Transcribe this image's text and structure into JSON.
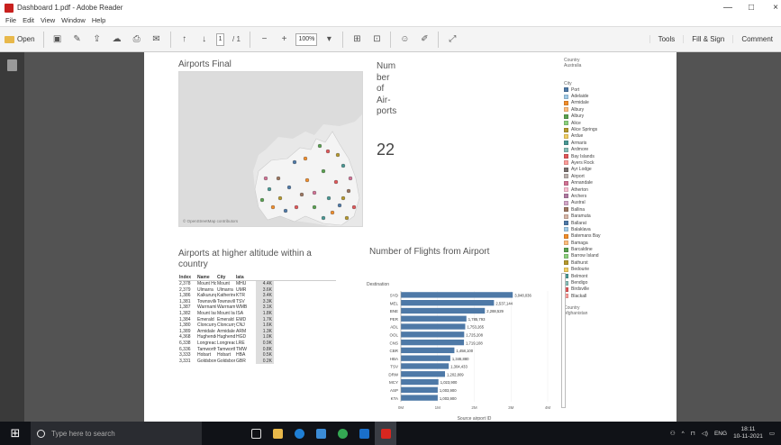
{
  "window": {
    "title": "Dashboard 1.pdf - Adobe Reader",
    "controls": [
      "—",
      "□",
      "×"
    ]
  },
  "menu": [
    "File",
    "Edit",
    "View",
    "Window",
    "Help"
  ],
  "toolbar": {
    "open_label": "Open",
    "page_current": "1",
    "page_total": "/ 1",
    "zoom": "100%",
    "right_tabs": [
      "Tools",
      "Fill & Sign",
      "Comment"
    ]
  },
  "dashboard": {
    "map_title": "Airports Final",
    "map_attribution": "© OpenStreetMap contributors",
    "num_title_lines": [
      "Num",
      "ber",
      "of",
      "Air-",
      "ports"
    ],
    "num_value": "22",
    "table_title_lines": [
      "Airports at higher altitude within a",
      "country"
    ],
    "table_headers": [
      "Index",
      "Name",
      "City",
      "Iata",
      ""
    ],
    "table_rows": [
      [
        "2,378",
        "Mount Hotham",
        "Mount",
        "MHU",
        "4.4K"
      ],
      [
        "2,379",
        "Ulmarra",
        "Ulmarra",
        "UMR",
        "3.6K"
      ],
      [
        "1,386",
        "Kalkurung",
        "Katherine",
        "KTR",
        "3.4K"
      ],
      [
        "1,381",
        "Townsville",
        "Townsville",
        "TSV",
        "3.3K"
      ],
      [
        "1,387",
        "Warrnambool",
        "Warrnambool",
        "WMB",
        "3.1K"
      ],
      [
        "1,382",
        "Mount Isa",
        "Mount Isa",
        "ISA",
        "1.8K"
      ],
      [
        "1,384",
        "Emerald",
        "Emerald",
        "EMD",
        "1.7K"
      ],
      [
        "1,380",
        "Cloncurry",
        "Cloncurry",
        "CNJ",
        "1.6K"
      ],
      [
        "1,389",
        "Armidale",
        "Armidale",
        "ARM",
        "1.3K"
      ],
      [
        "4,368",
        "Hughenden",
        "Hughenden",
        "HGD",
        "1.0K"
      ],
      [
        "6,338",
        "Longreach",
        "Longreach",
        "LRE",
        "0.9K"
      ],
      [
        "6,336",
        "Tamworth",
        "Tamworth",
        "TMW",
        "0.8K"
      ],
      [
        "3,333",
        "Hobart",
        "Hobart",
        "HBA",
        "0.5K"
      ],
      [
        "3,331",
        "Goldsborough",
        "Goldsborough",
        "GBR",
        "0.2K"
      ]
    ],
    "chart_title": "Number of Flights from Airport",
    "legend_country_label": "Country",
    "legend_country_value": "Australia",
    "legend_city_label": "City",
    "legend_cities": [
      {
        "name": "Port",
        "color": "#4e79a7"
      },
      {
        "name": "Adelaide",
        "color": "#a0cbe8"
      },
      {
        "name": "Armidale",
        "color": "#f28e2b"
      },
      {
        "name": "Albury",
        "color": "#ffbe7d"
      },
      {
        "name": "Albury",
        "color": "#59a14f"
      },
      {
        "name": "Alice",
        "color": "#8cd17d"
      },
      {
        "name": "Alice Springs",
        "color": "#b6992d"
      },
      {
        "name": "Ardue",
        "color": "#f1ce63"
      },
      {
        "name": "Armaris",
        "color": "#499894"
      },
      {
        "name": "Ardmore",
        "color": "#86bcb6"
      },
      {
        "name": "Bay Islands",
        "color": "#e15759"
      },
      {
        "name": "Ayers Rock",
        "color": "#ff9d9a"
      },
      {
        "name": "Ayr Lodge",
        "color": "#79706e"
      },
      {
        "name": "Airport",
        "color": "#bab0ac"
      },
      {
        "name": "Annandale",
        "color": "#d37295"
      },
      {
        "name": "Atherton",
        "color": "#fabfd2"
      },
      {
        "name": "Archers",
        "color": "#b07aa1"
      },
      {
        "name": "Austral",
        "color": "#d4a6c8"
      },
      {
        "name": "Ballina",
        "color": "#9d7660"
      },
      {
        "name": "Baramuta",
        "color": "#d7b5a6"
      },
      {
        "name": "Ballarat",
        "color": "#4e79a7"
      },
      {
        "name": "Balaklava",
        "color": "#a0cbe8"
      },
      {
        "name": "Batemans Bay",
        "color": "#f28e2b"
      },
      {
        "name": "Bamaga",
        "color": "#ffbe7d"
      },
      {
        "name": "Barcaldine",
        "color": "#59a14f"
      },
      {
        "name": "Barrow Island",
        "color": "#8cd17d"
      },
      {
        "name": "Bathurst",
        "color": "#b6992d"
      },
      {
        "name": "Bedourie",
        "color": "#f1ce63"
      },
      {
        "name": "Belmont",
        "color": "#499894"
      },
      {
        "name": "Bendigo",
        "color": "#86bcb6"
      },
      {
        "name": "Birdsville",
        "color": "#e15759"
      },
      {
        "name": "Blackall",
        "color": "#ff9d9a"
      }
    ],
    "legend_country2_label": "Country",
    "legend_country2_value": "Afghanistan"
  },
  "chart_data": {
    "type": "bar",
    "title": "Number of Flights from Airport",
    "ylabel": "Destination",
    "xlabel": "Source airport ID",
    "categories": [
      "SYD",
      "MEL",
      "BNE",
      "PER",
      "ADL",
      "OOL",
      "CNS",
      "CBR",
      "HBA",
      "TSV",
      "DRW",
      "MCY",
      "ASP",
      "KTA"
    ],
    "values": [
      3048036,
      2537144,
      2288529,
      1785793,
      1753265,
      1725208,
      1719108,
      1458100,
      1346880,
      1304433,
      1202809,
      1023900,
      1003900,
      1003900
    ],
    "value_labels": [
      "3,048,036",
      "2,537,144",
      "2,288,529",
      "1,785,793",
      "1,753,265",
      "1,725,208",
      "1,719,108",
      "1,458,100",
      "1,346,880",
      "1,304,433",
      "1,202,809",
      "1,023,900",
      "1,003,900",
      "1,003,900"
    ],
    "xticks": [
      "0M",
      "1M",
      "2M",
      "3M",
      "4M"
    ],
    "xlim": [
      0,
      4000000
    ],
    "bar_color": "#4e79a7"
  },
  "taskbar": {
    "search_placeholder": "Type here to search",
    "tray_text": "ENG",
    "time": "18:11",
    "date": "10-11-2021",
    "apps": [
      "task-view",
      "file-explorer",
      "edge",
      "store",
      "chrome",
      "mail",
      "adobe-reader"
    ]
  }
}
